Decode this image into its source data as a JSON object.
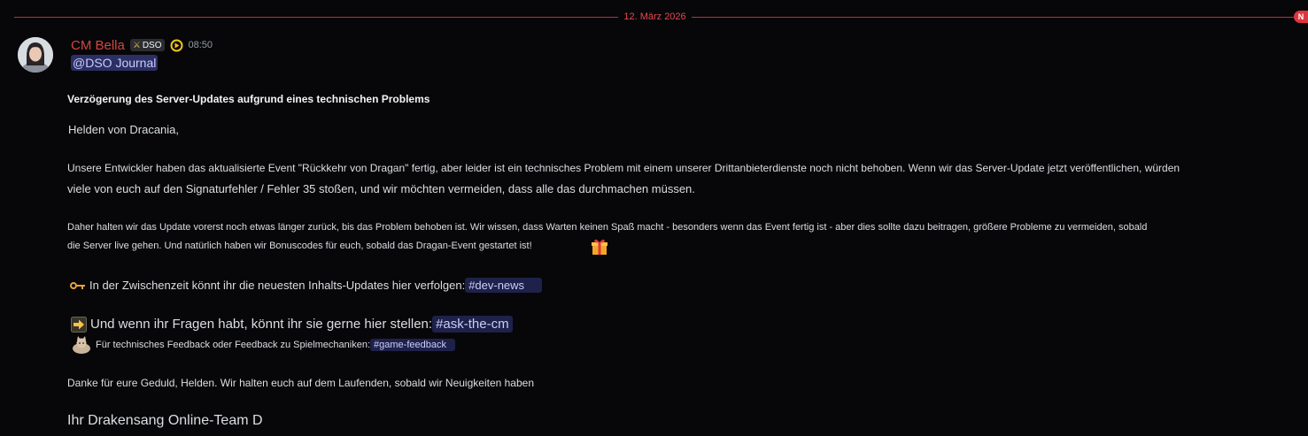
{
  "divider": {
    "date": "12. März 2026",
    "new_label": "N"
  },
  "message": {
    "author": "CM Bella",
    "tag": "DSO",
    "timestamp": "08:50",
    "mention": "@DSO Journal",
    "title": "Verzögerung des Server-Updates aufgrund eines technischen Problems",
    "greeting": "Helden von Dracania,",
    "para1_line1": "Unsere Entwickler haben das aktualisierte Event \"Rückkehr von Dragan\" fertig, aber leider ist ein technisches Problem mit einem unserer Drittanbieterdienste noch nicht behoben. Wenn wir das Server-Update jetzt veröffentlichen, würden",
    "para1_line2": "viele von euch auf den Signaturfehler / Fehler 35 stoßen, und wir möchten vermeiden, dass alle das durchmachen müssen.",
    "para2_line1": "Daher halten wir das Update vorerst noch etwas länger zurück, bis das Problem behoben ist. Wir wissen, dass Warten keinen Spaß macht - besonders wenn das Event fertig ist - aber dies sollte dazu beitragen, größere Probleme zu vermeiden, sobald",
    "para2_line2": "die Server live gehen. Und natürlich haben wir Bonuscodes für euch, sobald das Dragan-Event gestartet ist!",
    "devnews_text": "In der Zwischenzeit könnt ihr die neuesten Inhalts-Updates hier verfolgen: ",
    "devnews_channel": "#dev-news",
    "ask_text": "Und wenn ihr Fragen habt, könnt ihr sie gerne hier stellen: ",
    "ask_channel": "#ask-the-cm",
    "feedback_text": "Für technisches Feedback oder Feedback zu Spielmechaniken: ",
    "feedback_channel": "#game-feedback",
    "thanks": "Danke für eure Geduld, Helden. Wir halten euch auf dem Laufenden, sobald wir Neuigkeiten haben",
    "signature": "Ihr Drakensang Online-Team D"
  },
  "colors": {
    "divider": "#e5484f",
    "username": "#d4463e",
    "mention_bg": "#2c2f63",
    "channel_bg": "#1e2149",
    "background": "#070709"
  },
  "icons": [
    "sword-icon",
    "nitro-badge-icon",
    "gift-emoji",
    "key-emoji",
    "arrow-right-emoji",
    "cat-emoji"
  ]
}
